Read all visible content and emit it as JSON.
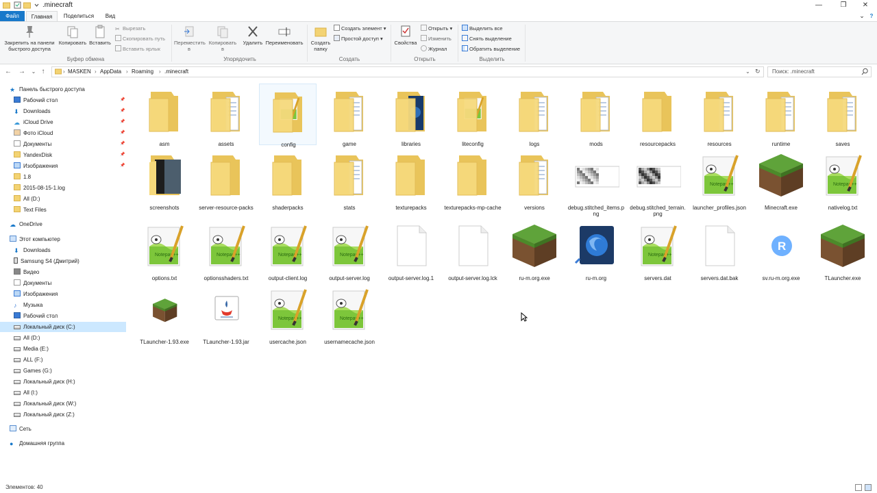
{
  "window": {
    "title": ".minecraft",
    "controls": [
      "—",
      "❐",
      "✕"
    ]
  },
  "tabs": [
    {
      "label": "Файл",
      "kind": "file"
    },
    {
      "label": "Главная",
      "kind": "active"
    },
    {
      "label": "Поделиться",
      "kind": "normal"
    },
    {
      "label": "Вид",
      "kind": "normal"
    }
  ],
  "ribbon": {
    "clipboard": {
      "pin_label": "Закрепить на панели быстрого доступа",
      "copy_label": "Копировать",
      "paste_label": "Вставить",
      "cut_label": "Вырезать",
      "copy_path_label": "Скопировать путь",
      "paste_shortcut_label": "Вставить ярлык",
      "group_label": "Буфер обмена"
    },
    "organize": {
      "move_label": "Переместить в",
      "copy_to_label": "Копировать в",
      "delete_label": "Удалить",
      "rename_label": "Переименовать",
      "group_label": "Упорядочить"
    },
    "create": {
      "new_folder_label": "Создать папку",
      "new_item_label": "Создать элемент",
      "easy_access_label": "Простой доступ",
      "group_label": "Создать"
    },
    "open": {
      "properties_label": "Свойства",
      "open_label": "Открыть",
      "edit_label": "Изменить",
      "history_label": "Журнал",
      "group_label": "Открыть"
    },
    "select": {
      "select_all_label": "Выделить все",
      "select_none_label": "Снять выделение",
      "invert_label": "Обратить выделение",
      "group_label": "Выделить"
    }
  },
  "address": {
    "crumbs": [
      "MASKEN",
      "AppData",
      "Roaming",
      ".minecraft"
    ],
    "search_placeholder": "Поиск: .minecraft"
  },
  "nav": {
    "quick_access": "Панель быстрого доступа",
    "quick_items": [
      {
        "label": "Рабочий стол",
        "icon": "desktop-icon",
        "pinned": true
      },
      {
        "label": "Downloads",
        "icon": "download-icon",
        "pinned": true
      },
      {
        "label": "iCloud Drive",
        "icon": "cloud-icon",
        "pinned": true
      },
      {
        "label": "Фото iCloud",
        "icon": "photos-icon",
        "pinned": true
      },
      {
        "label": "Документы",
        "icon": "documents-icon",
        "pinned": true
      },
      {
        "label": "YandexDisk",
        "icon": "folder-icon",
        "pinned": true
      },
      {
        "label": "Изображения",
        "icon": "pictures-icon",
        "pinned": true
      },
      {
        "label": "1.8",
        "icon": "folder-icon",
        "pinned": false
      },
      {
        "label": "2015-08-15-1.log",
        "icon": "folder-icon",
        "pinned": false
      },
      {
        "label": "All (D:)",
        "icon": "folder-icon",
        "pinned": false
      },
      {
        "label": "Text Files",
        "icon": "folder-icon",
        "pinned": false
      }
    ],
    "onedrive": "OneDrive",
    "this_pc": "Этот компьютер",
    "pc_items": [
      {
        "label": "Downloads",
        "icon": "download-icon"
      },
      {
        "label": "Samsung S4 (Дмитрий)",
        "icon": "phone-icon"
      },
      {
        "label": "Видео",
        "icon": "video-icon"
      },
      {
        "label": "Документы",
        "icon": "documents-icon"
      },
      {
        "label": "Изображения",
        "icon": "pictures-icon"
      },
      {
        "label": "Музыка",
        "icon": "music-icon"
      },
      {
        "label": "Рабочий стол",
        "icon": "desktop-icon"
      },
      {
        "label": "Локальный диск (C:)",
        "icon": "drive-icon",
        "selected": true
      },
      {
        "label": "All (D:)",
        "icon": "drive-icon"
      },
      {
        "label": "Media (E:)",
        "icon": "drive-icon"
      },
      {
        "label": "ALL (F:)",
        "icon": "drive-icon"
      },
      {
        "label": "Games (G:)",
        "icon": "drive-icon"
      },
      {
        "label": "Локальный диск (H:)",
        "icon": "drive-icon"
      },
      {
        "label": "All (I:)",
        "icon": "drive-icon"
      },
      {
        "label": "Локальный диск (W:)",
        "icon": "drive-icon"
      },
      {
        "label": "Локальный диск (Z:)",
        "icon": "drive-icon"
      }
    ],
    "network": "Сеть",
    "homegroup": "Домашняя группа"
  },
  "files": [
    {
      "name": "asm",
      "type": "folder"
    },
    {
      "name": "assets",
      "type": "folder-docs"
    },
    {
      "name": "config",
      "type": "folder-notepad",
      "selected": true
    },
    {
      "name": "game",
      "type": "folder-docs"
    },
    {
      "name": "libraries",
      "type": "folder-dark"
    },
    {
      "name": "liteconfig",
      "type": "folder-notepad"
    },
    {
      "name": "logs",
      "type": "folder-docs"
    },
    {
      "name": "mods",
      "type": "folder-docs"
    },
    {
      "name": "resourcepacks",
      "type": "folder"
    },
    {
      "name": "resources",
      "type": "folder-docs"
    },
    {
      "name": "runtime",
      "type": "folder-docs"
    },
    {
      "name": "saves",
      "type": "folder-docs"
    },
    {
      "name": "screenshots",
      "type": "folder-photo"
    },
    {
      "name": "server-resource-packs",
      "type": "folder"
    },
    {
      "name": "shaderpacks",
      "type": "folder"
    },
    {
      "name": "stats",
      "type": "folder-docs"
    },
    {
      "name": "texturepacks",
      "type": "folder"
    },
    {
      "name": "texturepacks-mp-cache",
      "type": "folder"
    },
    {
      "name": "versions",
      "type": "folder-docs"
    },
    {
      "name": "debug.stitched_items.png",
      "type": "image-noise"
    },
    {
      "name": "debug.stitched_terrain.png",
      "type": "image-noise2"
    },
    {
      "name": "launcher_profiles.json",
      "type": "notepad"
    },
    {
      "name": "Minecraft.exe",
      "type": "grass"
    },
    {
      "name": "nativelog.txt",
      "type": "notepad"
    },
    {
      "name": "options.txt",
      "type": "notepad"
    },
    {
      "name": "optionsshaders.txt",
      "type": "notepad"
    },
    {
      "name": "output-client.log",
      "type": "notepad"
    },
    {
      "name": "output-server.log",
      "type": "notepad"
    },
    {
      "name": "output-server.log.1",
      "type": "blank"
    },
    {
      "name": "output-server.log.lck",
      "type": "blank"
    },
    {
      "name": "ru-m.org.exe",
      "type": "grass"
    },
    {
      "name": "ru-m.org",
      "type": "firefox"
    },
    {
      "name": "servers.dat",
      "type": "notepad"
    },
    {
      "name": "servers.dat.bak",
      "type": "blank"
    },
    {
      "name": "sv.ru-m.org.exe",
      "type": "r-app"
    },
    {
      "name": "TLauncher.exe",
      "type": "grass"
    },
    {
      "name": "TLauncher-1.93.exe",
      "type": "grass-small"
    },
    {
      "name": "TLauncher-1.93.jar",
      "type": "java"
    },
    {
      "name": "usercache.json",
      "type": "notepad"
    },
    {
      "name": "usernamecache.json",
      "type": "notepad"
    }
  ],
  "status": {
    "items_count": "Элементов: 40"
  }
}
